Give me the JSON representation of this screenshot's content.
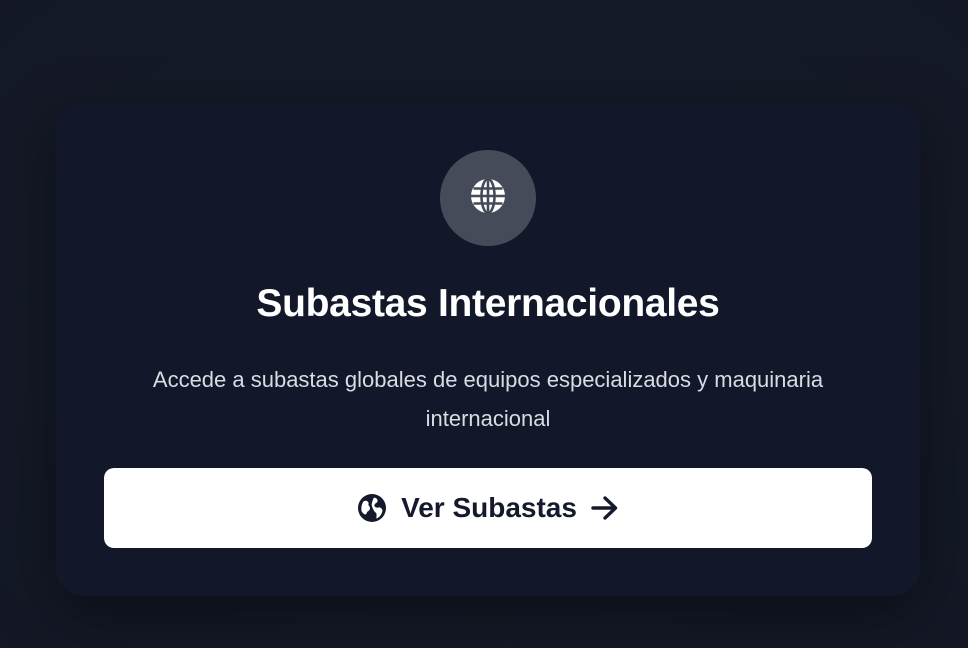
{
  "card": {
    "icon": "globe-icon",
    "title": "Subastas Internacionales",
    "description": "Accede a subastas globales de equipos especializados y maquinaria internacional",
    "button": {
      "label": "Ver Subastas",
      "leading_icon": "earth-globe-icon",
      "trailing_icon": "arrow-right-icon"
    }
  },
  "colors": {
    "background": "#151a28",
    "card": "#121729",
    "icon_circle": "#464b59",
    "button": "#ffffff",
    "button_text": "#141a2c"
  }
}
